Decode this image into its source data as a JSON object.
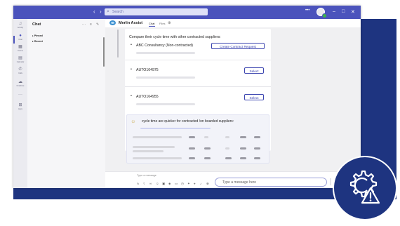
{
  "search": {
    "placeholder": "Search"
  },
  "window_controls": {
    "more": "•••",
    "minimize": "–",
    "maximize": "□",
    "close": "✕"
  },
  "rail": {
    "items": [
      {
        "label": "Activity",
        "icon": "bell-icon"
      },
      {
        "label": "Chat",
        "icon": "chat-icon"
      },
      {
        "label": "Teams",
        "icon": "teams-icon"
      },
      {
        "label": "Calendar",
        "icon": "calendar-icon"
      },
      {
        "label": "Calls",
        "icon": "phone-icon"
      },
      {
        "label": "OneDrive",
        "icon": "cloud-icon"
      },
      {
        "label": "Apps",
        "icon": "apps-icon"
      }
    ]
  },
  "chat_pane": {
    "title": "Chat",
    "items": [
      "Pinned",
      "Recent"
    ]
  },
  "chat_header": {
    "bot_name": "Merlin Assist",
    "tabs": [
      "Chat",
      "Files"
    ],
    "add_tab": "⊕"
  },
  "card": {
    "compare_text": "Compare their cycle time with other contracted suppliers:",
    "suppliers": [
      {
        "name": "ABC Consultancy (Non-contracted)",
        "button": "Create Contract Request"
      },
      {
        "name": "AUTO164975",
        "button": "Select"
      },
      {
        "name": "AUTO164955",
        "button": "Select"
      }
    ],
    "insight_text": "cycle time are quicker for contracted /on boarded suppliers:"
  },
  "compose": {
    "placeholder": "Type a message",
    "input_placeholder": "Type a message here"
  },
  "colors": {
    "titlebar": "#4b53bc",
    "brand_navy": "#1e3480",
    "accent": "#3c45b0"
  },
  "badge": {
    "icon": "gear-warning-icon"
  }
}
